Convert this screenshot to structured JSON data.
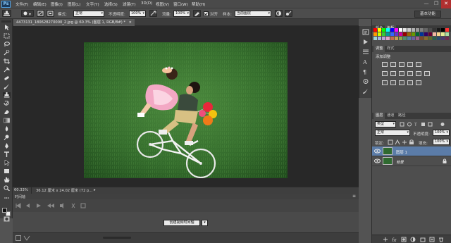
{
  "app": {
    "logo": "Ps"
  },
  "menu": [
    "文件(F)",
    "编辑(E)",
    "图像(I)",
    "图层(L)",
    "文字(Y)",
    "选择(S)",
    "滤镜(T)",
    "3D(D)",
    "视图(V)",
    "窗口(W)",
    "帮助(H)"
  ],
  "window_controls": {
    "minimize": "—",
    "restore": "❐",
    "close": "✕"
  },
  "options": {
    "mode_label": "模式:",
    "mode_value": "正常",
    "opacity_label": "不透明度:",
    "opacity_value": "100%",
    "flow_label": "流量:",
    "flow_value": "100%",
    "align_label": "对齐",
    "sample_label": "样本:",
    "sample_value": "当前图层",
    "workspace": "基本功能"
  },
  "document": {
    "tab_title": "4473131_180628270000_2.jpg @ 60.3% (图层 1, RGB/8#) *",
    "tab_close": "×"
  },
  "status": {
    "zoom": "60.33%",
    "doc_info": "文档:36.1M/72.2M",
    "size": "36.12 厘米 x 24.02 厘米 (72 p...",
    "arrow": "▸"
  },
  "timeline": {
    "title": "时间轴",
    "create_button": "创建视频时间轴",
    "dropdown": "▾"
  },
  "color_panel": {
    "tabs": [
      "颜色",
      "色板"
    ],
    "active": 1
  },
  "swatches": [
    "#ff0000",
    "#ffff00",
    "#00ff00",
    "#00ffff",
    "#0000ff",
    "#ff00ff",
    "#ffffff",
    "#e6e6e6",
    "#cccccc",
    "#b3b3b3",
    "#999999",
    "#808080",
    "#666666",
    "#4d4d4d",
    "#333333",
    "#1a1a1a",
    "#000000",
    "#ff3333",
    "#ff9900",
    "#ccff00",
    "#33cc33",
    "#009999",
    "#3366ff",
    "#6633cc",
    "#cc0099",
    "#990000",
    "#996600",
    "#669900",
    "#006633",
    "#003399",
    "#330066",
    "#660033",
    "#f2b5a0",
    "#f9d28a",
    "#e4ec95",
    "#a9dca4",
    "#9fd6d8",
    "#a3b6e6",
    "#b9a4d8",
    "#e3a3c8",
    "#c46b4f",
    "#c9a04f",
    "#8fa64a",
    "#4f8f6a",
    "#4f7fa4",
    "#6b5f9f",
    "#9f5f86",
    "#7a4a2a",
    "#8a6a2a",
    "#5e6a2a",
    "#2a5e4a",
    "#2a4a6e",
    "#4a3a6e",
    "#6e2a4e"
  ],
  "adjust_panel": {
    "tabs": [
      "调整",
      "样式"
    ],
    "active": 0,
    "title": "添加调整"
  },
  "layers_panel": {
    "tabs": [
      "图层",
      "通道",
      "路径"
    ],
    "active": 0,
    "kind_label": "类型",
    "blend_mode": "正常",
    "opacity_label": "不透明度:",
    "opacity_value": "100%",
    "lock_label": "锁定:",
    "fill_label": "填充:",
    "fill_value": "100%",
    "layers": [
      {
        "name": "图层 1",
        "selected": true
      },
      {
        "name": "背景",
        "selected": false
      }
    ]
  }
}
